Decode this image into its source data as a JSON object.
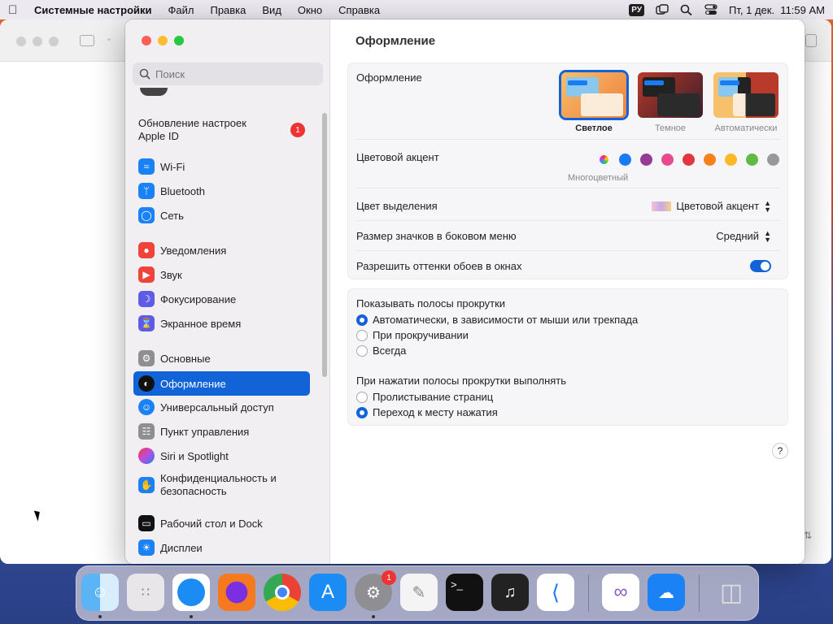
{
  "menubar": {
    "app": "Системные настройки",
    "items": [
      "Файл",
      "Правка",
      "Вид",
      "Окно",
      "Справка"
    ],
    "lang": "РУ",
    "datetime": "Пт, 1 дек.  11:59 AM"
  },
  "sidebar": {
    "search_placeholder": "Поиск",
    "apple_id": {
      "label": "Обновление настроек Apple ID",
      "badge": "1"
    },
    "items": [
      {
        "label": "Wi-Fi",
        "color": "#1a82f5"
      },
      {
        "label": "Bluetooth",
        "color": "#1a82f5"
      },
      {
        "label": "Сеть",
        "color": "#1a82f5"
      },
      {
        "label": "Уведомления",
        "color": "#f0433a"
      },
      {
        "label": "Звук",
        "color": "#f0433a"
      },
      {
        "label": "Фокусирование",
        "color": "#5e5ce6"
      },
      {
        "label": "Экранное время",
        "color": "#5e5ce6"
      },
      {
        "label": "Основные",
        "color": "#8e8e93"
      },
      {
        "label": "Оформление",
        "color": "#111111"
      },
      {
        "label": "Универсальный доступ",
        "color": "#1a82f5"
      },
      {
        "label": "Пункт управления",
        "color": "#8e8e93"
      },
      {
        "label": "Siri и Spotlight",
        "color": "#b84ee0"
      },
      {
        "label": "Конфиденциальность и безопасность",
        "color": "#1a82f5"
      },
      {
        "label": "Рабочий стол и Dock",
        "color": "#111111"
      },
      {
        "label": "Дисплеи",
        "color": "#1a82f5"
      }
    ]
  },
  "main": {
    "title": "Оформление",
    "appearance": {
      "label": "Оформление",
      "options": [
        "Светлое",
        "Темное",
        "Автоматически"
      ],
      "selected": "Светлое"
    },
    "accent": {
      "label": "Цветовой акцент",
      "caption": "Многоцветный",
      "colors": [
        "multicolor",
        "#1a7cf5",
        "#953d96",
        "#e84a8e",
        "#e0383e",
        "#f7821b",
        "#fcb827",
        "#62ba46",
        "#989898"
      ]
    },
    "highlight": {
      "label": "Цвет выделения",
      "value": "Цветовой акцент"
    },
    "sidebar_icon_size": {
      "label": "Размер значков в боковом меню",
      "value": "Средний"
    },
    "wallpaper_tint": {
      "label": "Разрешить оттенки обоев в окнах",
      "on": true
    },
    "scrollbars": {
      "label": "Показывать полосы прокрутки",
      "options": [
        "Автоматически, в зависимости от мыши или трекпада",
        "При прокручивании",
        "Всегда"
      ],
      "selected": 0
    },
    "click": {
      "label": "При нажатии полосы прокрутки выполнять",
      "options": [
        "Пролистывание страниц",
        "Переход к месту нажатия"
      ],
      "selected": 1
    },
    "help": "?"
  },
  "dock": {
    "apps": [
      "Finder",
      "Launchpad",
      "Safari",
      "Firefox",
      "Chrome",
      "App Store",
      "System Settings",
      "TextEdit",
      "Terminal",
      "GarageBand",
      "VS Code",
      "Visual Studio",
      "Weather",
      "Trash"
    ],
    "settings_badge": "1"
  }
}
